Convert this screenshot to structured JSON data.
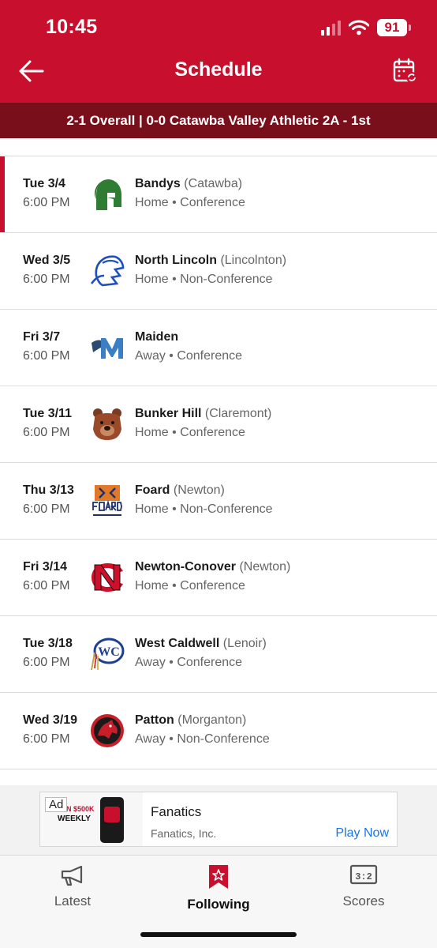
{
  "status": {
    "time": "10:45",
    "battery": "91"
  },
  "header": {
    "title": "Schedule",
    "record": "2-1 Overall | 0-0 Catawba Valley Athletic 2A - 1st"
  },
  "games": [
    {
      "date": "Tue 3/4",
      "time": "6:00 PM",
      "opponent": "Bandys",
      "city": "(Catawba)",
      "meta": "Home • Conference",
      "logo_icon": "spartan-helmet-green"
    },
    {
      "date": "Wed 3/5",
      "time": "6:00 PM",
      "opponent": "North Lincoln",
      "city": "(Lincolnton)",
      "meta": "Home • Non-Conference",
      "logo_icon": "knight-helmet-blue"
    },
    {
      "date": "Fri 3/7",
      "time": "6:00 PM",
      "opponent": "Maiden",
      "city": "",
      "meta": "Away • Conference",
      "logo_icon": "blue-m-logo"
    },
    {
      "date": "Tue 3/11",
      "time": "6:00 PM",
      "opponent": "Bunker Hill",
      "city": "(Claremont)",
      "meta": "Home • Conference",
      "logo_icon": "bear-head-brown"
    },
    {
      "date": "Thu 3/13",
      "time": "6:00 PM",
      "opponent": "Foard",
      "city": "(Newton)",
      "meta": "Home • Non-Conference",
      "logo_icon": "foard-tiger-logo"
    },
    {
      "date": "Fri 3/14",
      "time": "6:00 PM",
      "opponent": "Newton-Conover",
      "city": "(Newton)",
      "meta": "Home • Conference",
      "logo_icon": "nc-monogram-red"
    },
    {
      "date": "Tue 3/18",
      "time": "6:00 PM",
      "opponent": "West Caldwell",
      "city": "(Lenoir)",
      "meta": "Away • Conference",
      "logo_icon": "wc-circle-logo"
    },
    {
      "date": "Wed 3/19",
      "time": "6:00 PM",
      "opponent": "Patton",
      "city": "(Morganton)",
      "meta": "Away • Non-Conference",
      "logo_icon": "panther-circle-logo"
    }
  ],
  "ad": {
    "badge": "Ad",
    "promo_line1": "WIN $500K",
    "promo_line2": "WEEKLY",
    "title": "Fanatics",
    "subtitle": "Fanatics, Inc.",
    "cta": "Play Now"
  },
  "tabs": [
    {
      "label": "Latest",
      "icon": "megaphone-icon"
    },
    {
      "label": "Following",
      "icon": "bookmark-star-icon"
    },
    {
      "label": "Scores",
      "icon": "scoreboard-icon"
    }
  ],
  "colors": {
    "brand_red": "#c8102e",
    "record_bar": "#7a0f1c",
    "link_blue": "#1a73e8"
  }
}
